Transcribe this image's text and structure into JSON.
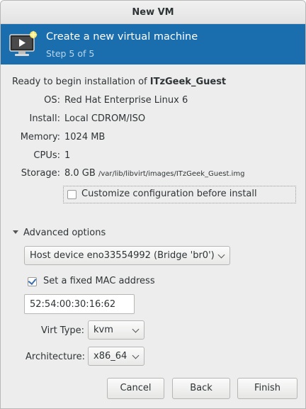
{
  "window": {
    "title": "New VM"
  },
  "banner": {
    "heading": "Create a new virtual machine",
    "step": "Step 5 of 5",
    "icon": "vm-monitor-icon"
  },
  "summary": {
    "ready_prefix": "Ready to begin installation of ",
    "vm_name": "ITzGeek_Guest",
    "rows": {
      "os": {
        "label": "OS:",
        "value": "Red Hat Enterprise Linux 6"
      },
      "install": {
        "label": "Install:",
        "value": "Local CDROM/ISO"
      },
      "memory": {
        "label": "Memory:",
        "value": "1024 MB"
      },
      "cpus": {
        "label": "CPUs:",
        "value": "1"
      },
      "storage": {
        "label": "Storage:",
        "value": "8.0 GB",
        "path": "/var/lib/libvirt/images/ITzGeek_Guest.img"
      }
    }
  },
  "customize": {
    "label": "Customize configuration before install",
    "checked": false
  },
  "advanced": {
    "expander_label": "Advanced options",
    "network_select": "Host device eno33554992 (Bridge 'br0')",
    "mac_checkbox_label": "Set a fixed MAC address",
    "mac_checked": true,
    "mac_value": "52:54:00:30:16:62",
    "virt_type_label": "Virt Type:",
    "virt_type_value": "kvm",
    "arch_label": "Architecture:",
    "arch_value": "x86_64"
  },
  "buttons": {
    "cancel": "Cancel",
    "back": "Back",
    "finish": "Finish"
  },
  "colors": {
    "banner": "#1b6eae",
    "window_bg": "#ededed"
  }
}
